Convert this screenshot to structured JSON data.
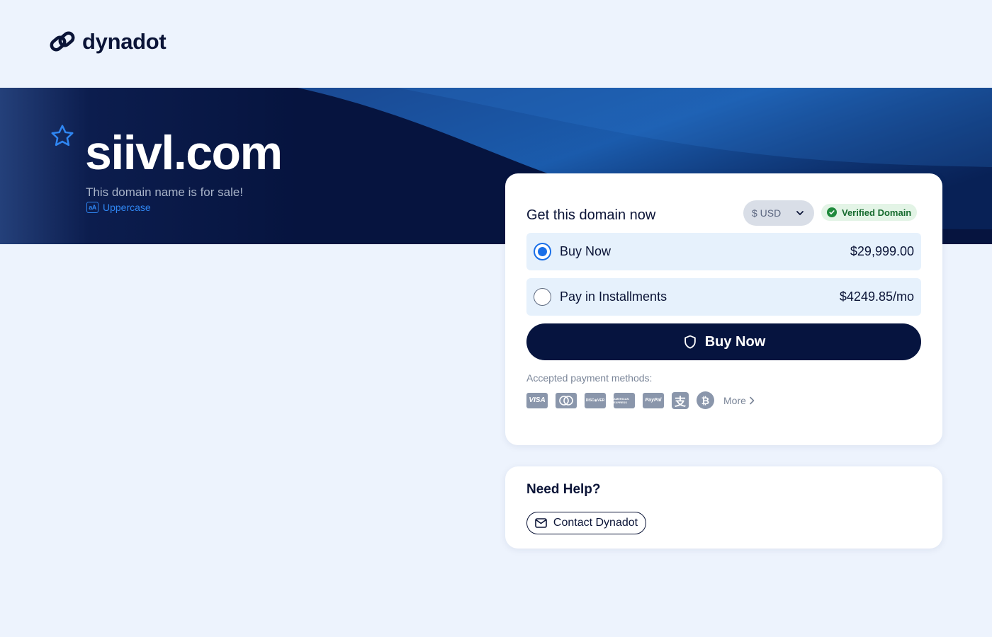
{
  "brand": {
    "name": "dynadot",
    "logo_icon": "chain-link-icon"
  },
  "hero": {
    "domain": "siivl.com",
    "subtitle": "This domain name is for sale!",
    "uppercase_label": "Uppercase",
    "favorite_icon": "star-icon"
  },
  "purchase": {
    "title": "Get this domain now",
    "currency": "$ USD",
    "verified_label": "Verified Domain",
    "options": [
      {
        "label": "Buy Now",
        "price": "$29,999.00",
        "selected": true
      },
      {
        "label": "Pay in Installments",
        "price": "$4249.85/mo",
        "selected": false
      }
    ],
    "buy_button_label": "Buy Now",
    "payment_label": "Accepted payment methods:",
    "payment_methods": [
      {
        "name": "visa",
        "text": "VISA"
      },
      {
        "name": "mastercard",
        "text": ""
      },
      {
        "name": "discover",
        "text": "DISC◉VER"
      },
      {
        "name": "amex",
        "text": "AMERICAN EXPRESS"
      },
      {
        "name": "paypal",
        "text": "PayPal"
      },
      {
        "name": "alipay",
        "text": "支"
      },
      {
        "name": "bitcoin",
        "text": "₿"
      }
    ],
    "more_label": "More"
  },
  "help": {
    "title": "Need Help?",
    "contact_label": "Contact Dynadot"
  },
  "colors": {
    "navy": "#06143f",
    "background": "#edf3fd",
    "accent_blue": "#1a6fe8",
    "verified_green": "#1f8a3c"
  }
}
